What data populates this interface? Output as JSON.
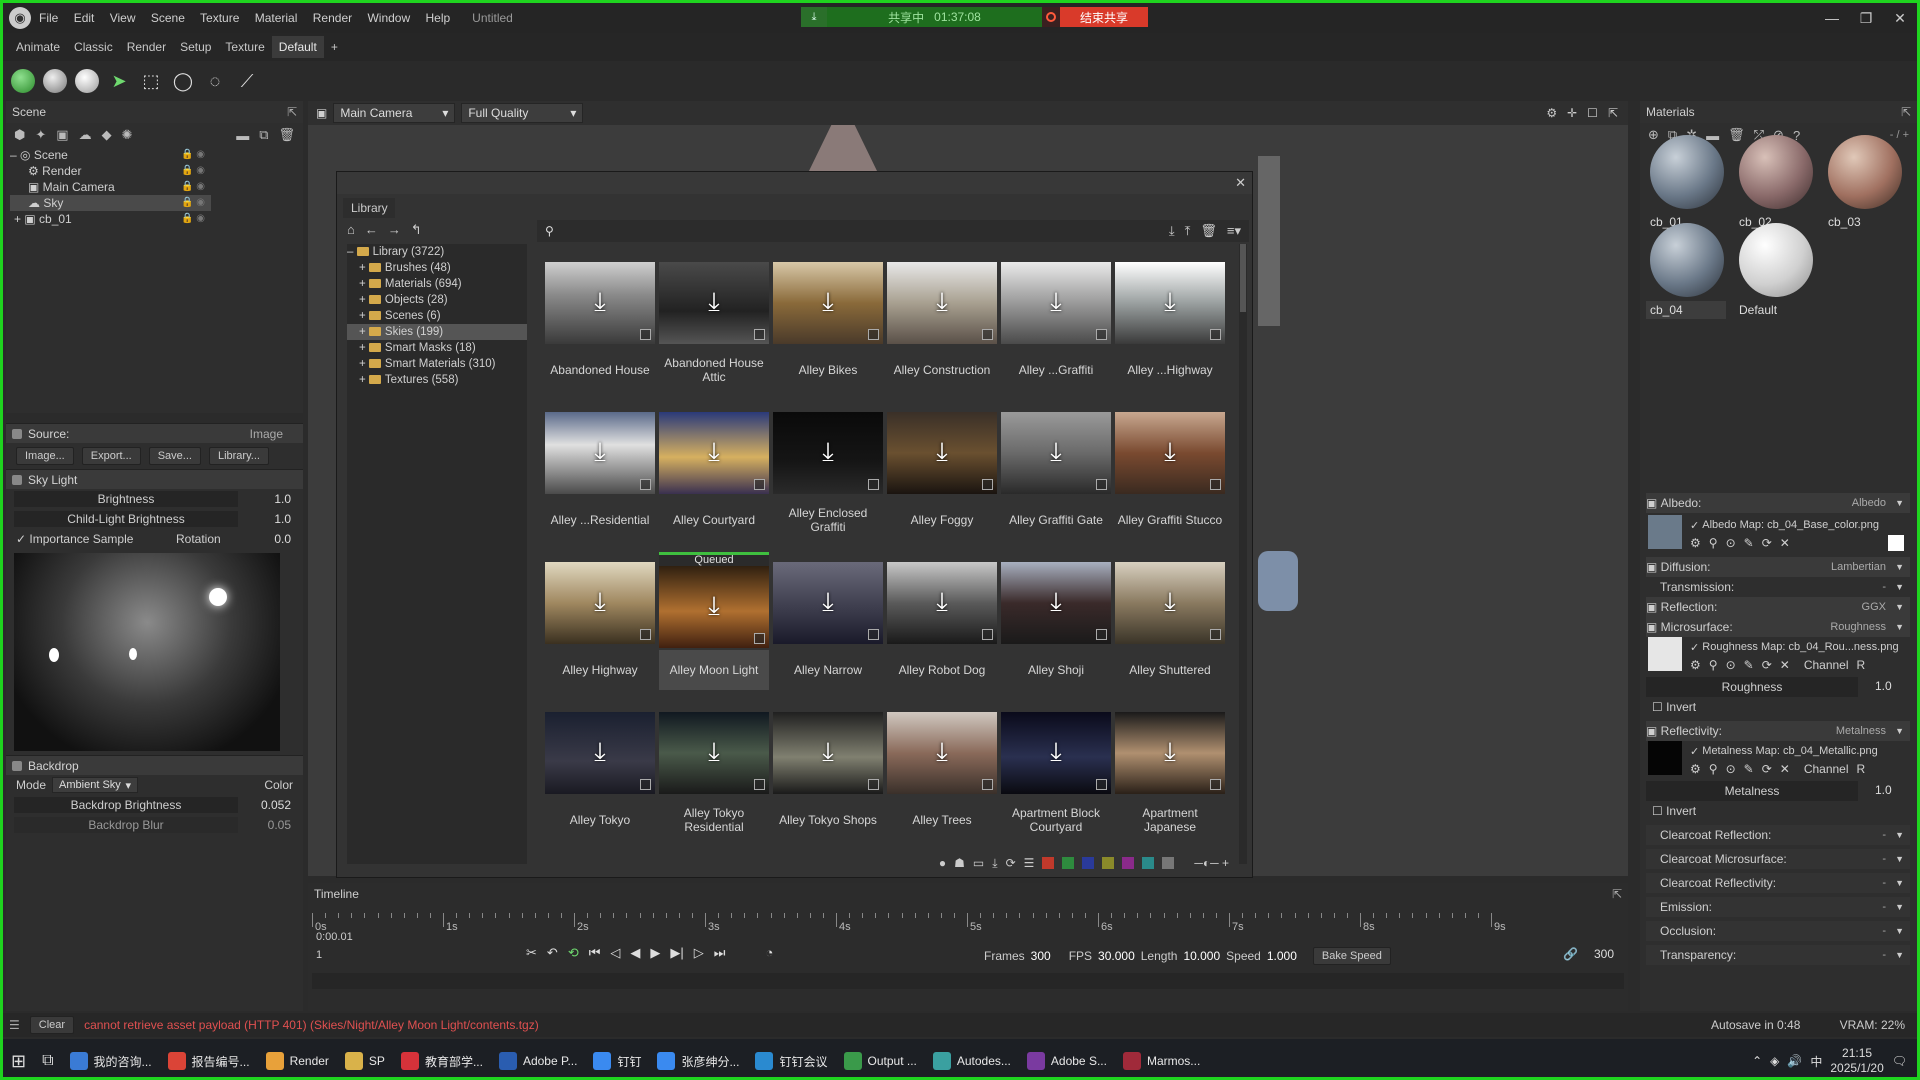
{
  "titlebar": {
    "menu": [
      "File",
      "Edit",
      "View",
      "Scene",
      "Texture",
      "Material",
      "Render",
      "Window",
      "Help"
    ],
    "title": "Untitled",
    "share_status": "共享中",
    "share_time": "01:37:08",
    "end_share": "结束共享"
  },
  "tabs": [
    "Animate",
    "Classic",
    "Render",
    "Setup",
    "Texture",
    "Default",
    "+"
  ],
  "scene_panel": {
    "title": "Scene",
    "tree": [
      "Scene",
      "Render",
      "Main Camera",
      "Sky",
      "cb_01"
    ]
  },
  "source": {
    "label": "Source:",
    "value": "Image",
    "buttons": [
      "Image...",
      "Export...",
      "Save...",
      "Library..."
    ]
  },
  "sky_light": {
    "title": "Sky Light",
    "brightness_label": "Brightness",
    "brightness": "1.0",
    "child_brightness_label": "Child-Light Brightness",
    "child_brightness": "1.0",
    "importance_label": "Importance Sample",
    "rotation_label": "Rotation",
    "rotation": "0.0"
  },
  "backdrop": {
    "title": "Backdrop",
    "mode_label": "Mode",
    "mode": "Ambient Sky",
    "color_label": "Color",
    "brightness_label": "Backdrop Brightness",
    "brightness": "0.052",
    "blur_label": "Backdrop Blur",
    "blur": "0.05"
  },
  "viewport": {
    "camera": "Main Camera",
    "quality": "Full Quality"
  },
  "library": {
    "tab": "Library",
    "tree": [
      "Library (3722)",
      "Brushes (48)",
      "Materials (694)",
      "Objects (28)",
      "Scenes (6)",
      "Skies (199)",
      "Smart Masks (18)",
      "Smart Materials (310)",
      "Textures (558)"
    ],
    "queued_label": "Queued",
    "items": [
      "Abandoned House",
      "Abandoned House Attic",
      "Alley Bikes",
      "Alley Construction",
      "Alley ...Graffiti",
      "Alley ...Highway",
      "Alley ...Residential",
      "Alley Courtyard",
      "Alley Enclosed Graffiti",
      "Alley Foggy",
      "Alley Graffiti Gate",
      "Alley Graffiti Stucco",
      "Alley Highway",
      "Alley Moon Light",
      "Alley Narrow",
      "Alley Robot Dog",
      "Alley Shoji",
      "Alley Shuttered",
      "Alley Tokyo",
      "Alley Tokyo Residential",
      "Alley Tokyo Shops",
      "Alley Trees",
      "Apartment Block Courtyard",
      "Apartment Japanese"
    ]
  },
  "materials": {
    "title": "Materials",
    "count": "- / +",
    "items": [
      "cb_01",
      "cb_02",
      "cb_03",
      "cb_04",
      "Default"
    ],
    "albedo": {
      "label": "Albedo:",
      "value": "Albedo",
      "map": "Albedo Map: cb_04_Base_color.png"
    },
    "diffusion": {
      "label": "Diffusion:",
      "value": "Lambertian"
    },
    "transmission": {
      "label": "Transmission:",
      "value": "-"
    },
    "reflection": {
      "label": "Reflection:",
      "value": "GGX"
    },
    "microsurface": {
      "label": "Microsurface:",
      "value": "Roughness",
      "map": "Roughness Map: cb_04_Rou...ness.png",
      "channel_label": "Channel",
      "channel": "R",
      "roughness_label": "Roughness",
      "roughness": "1.0",
      "invert": "Invert"
    },
    "reflectivity": {
      "label": "Reflectivity:",
      "value": "Metalness",
      "map": "Metalness Map: cb_04_Metallic.png",
      "channel_label": "Channel",
      "channel": "R",
      "metalness_label": "Metalness",
      "metalness": "1.0",
      "invert": "Invert"
    },
    "extra": [
      {
        "label": "Clearcoat Reflection:",
        "value": "-"
      },
      {
        "label": "Clearcoat Microsurface:",
        "value": "-"
      },
      {
        "label": "Clearcoat Reflectivity:",
        "value": "-"
      },
      {
        "label": "Emission:",
        "value": "-"
      },
      {
        "label": "Occlusion:",
        "value": "-"
      },
      {
        "label": "Transparency:",
        "value": "-"
      }
    ]
  },
  "timeline": {
    "title": "Timeline",
    "time": "0:00.01",
    "frame": "1",
    "ticks": [
      "0s",
      "1s",
      "2s",
      "3s",
      "4s",
      "5s",
      "6s",
      "7s",
      "8s",
      "9s"
    ],
    "frames_label": "Frames",
    "frames": "300",
    "fps_label": "FPS",
    "fps": "30.000",
    "length_label": "Length",
    "length": "10.000",
    "speed_label": "Speed",
    "speed": "1.000",
    "bake_speed": "Bake Speed",
    "end_frame": "300"
  },
  "status": {
    "clear": "Clear",
    "message": "cannot retrieve asset payload (HTTP 401) (Skies/Night/Alley Moon Light/contents.tgz)",
    "autosave": "Autosave in 0:48",
    "vram": "VRAM: 22%"
  },
  "taskbar": {
    "items": [
      "我的咨询...",
      "报告编号...",
      "Render",
      "SP",
      "教育部学...",
      "Adobe P...",
      "钉钉",
      "张彦绅分...",
      "钉钉会议",
      "Output ...",
      "Autodes...",
      "Adobe S...",
      "Marmos..."
    ],
    "time": "21:15",
    "date": "2025/1/20",
    "ime": "中"
  }
}
